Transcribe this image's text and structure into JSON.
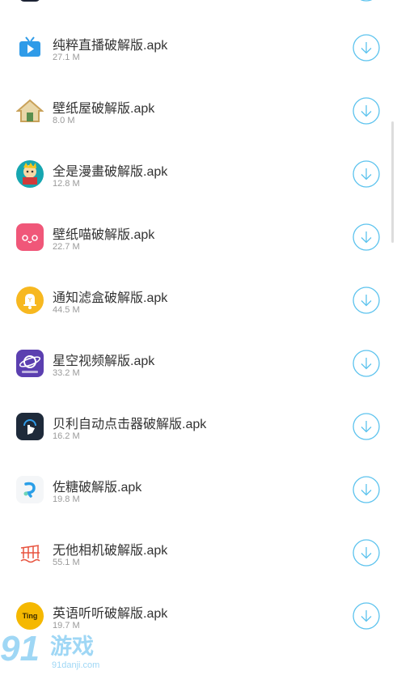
{
  "apps": [
    {
      "name": "纯粹直播破解版.apk",
      "size": "27.1 M",
      "icon": "tv-icon",
      "color": "#2f9be8"
    },
    {
      "name": "壁纸屋破解版.apk",
      "size": "8.0 M",
      "icon": "house-icon",
      "color": "#c9a25a"
    },
    {
      "name": "全是漫畫破解版.apk",
      "size": "12.8 M",
      "icon": "manga-reader-icon",
      "color": "#16a6b0"
    },
    {
      "name": "壁纸喵破解版.apk",
      "size": "22.7 M",
      "icon": "cat-face-icon",
      "color": "#f05779"
    },
    {
      "name": "通知滤盒破解版.apk",
      "size": "44.5 M",
      "icon": "bell-icon",
      "color": "#f7b820"
    },
    {
      "name": "星空视频解版.apk",
      "size": "33.2 M",
      "icon": "planet-icon",
      "color": "#5b3fb0"
    },
    {
      "name": "贝利自动点击器破解版.apk",
      "size": "16.2 M",
      "icon": "tap-finger-icon",
      "color": "#1e2a3a"
    },
    {
      "name": "佐糖破解版.apk",
      "size": "19.8 M",
      "icon": "zuotang-logo-icon",
      "color": "#2a9fe8"
    },
    {
      "name": "无他相机破解版.apk",
      "size": "55.1 M",
      "icon": "camera-grid-icon",
      "color": "#e8533f"
    },
    {
      "name": "英语听听破解版.apk",
      "size": "19.7 M",
      "icon": "tingting-logo-icon",
      "color": "#f5b800"
    }
  ],
  "ui": {
    "download_color": "#5cc3ee"
  },
  "watermark": {
    "brand": "游戏",
    "domain": "91danji.com",
    "number": "91"
  }
}
